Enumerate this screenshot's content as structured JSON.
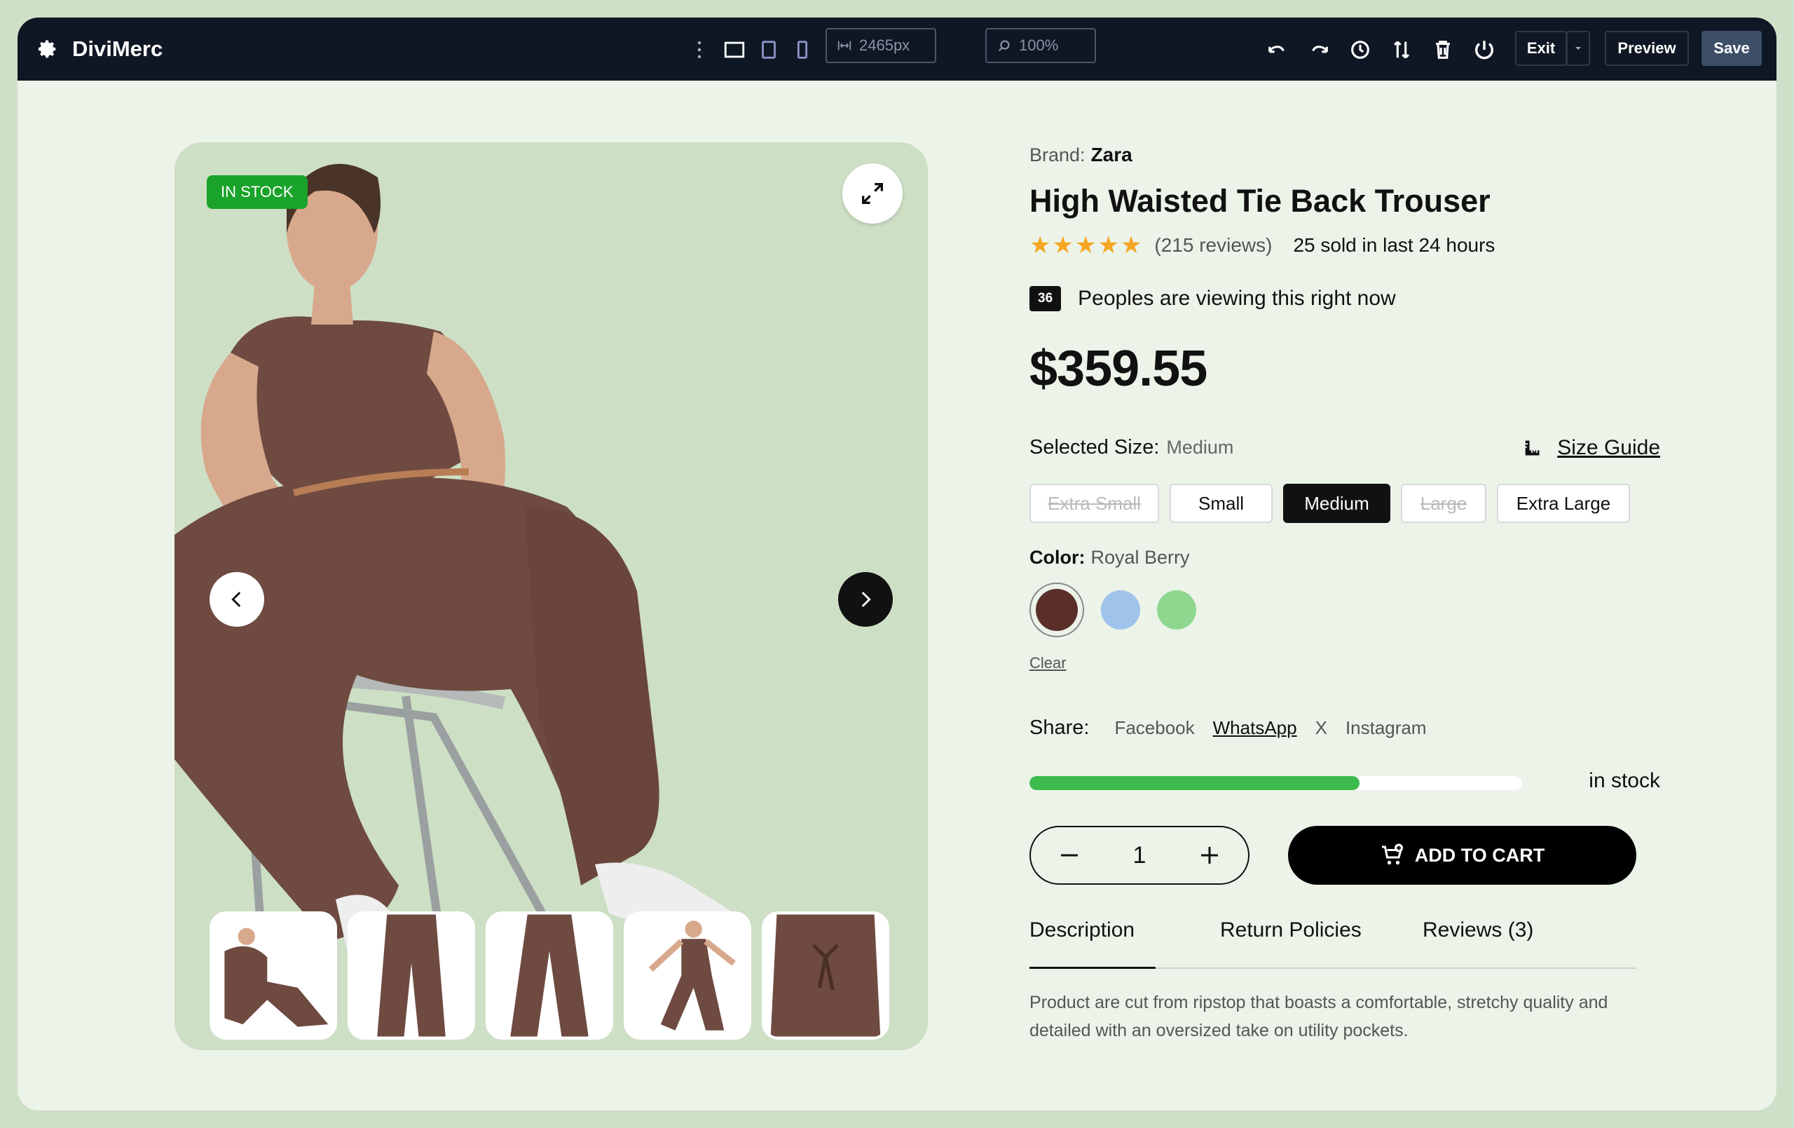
{
  "app": {
    "name": "DiviMerc",
    "width_display": "2465px",
    "zoom_display": "100%",
    "buttons": {
      "exit": "Exit",
      "preview": "Preview",
      "save": "Save"
    }
  },
  "gallery": {
    "badge": "IN STOCK",
    "thumb_count": 5
  },
  "product": {
    "brand_label": "Brand:",
    "brand": "Zara",
    "title": "High Waisted Tie Back Trouser",
    "rating": 5,
    "stars": "★★★★★",
    "reviews": "(215 reviews)",
    "sold": "25 sold in last 24 hours",
    "viewing_count": "36",
    "viewing_text": "Peoples are viewing this right now",
    "price": "$359.55",
    "size_label": "Selected Size:",
    "size_value": "Medium",
    "size_guide": "Size Guide",
    "sizes": [
      {
        "label": "Extra Small",
        "state": "disabled"
      },
      {
        "label": "Small",
        "state": "normal"
      },
      {
        "label": "Medium",
        "state": "active"
      },
      {
        "label": "Large",
        "state": "disabled"
      },
      {
        "label": "Extra Large",
        "state": "normal"
      }
    ],
    "color_label": "Color:",
    "color_value": "Royal Berry",
    "colors": [
      "#5a2f2a",
      "#9fc3ea",
      "#8fd68f"
    ],
    "clear": "Clear",
    "share_label": "Share:",
    "share_links": [
      "Facebook",
      "WhatsApp",
      "X",
      "Instagram"
    ],
    "stock_fraction": 0.67,
    "stock_text": "in stock",
    "quantity": "1",
    "add_to_cart": "ADD TO CART",
    "tabs": [
      "Description",
      "Return Policies",
      "Reviews (3)"
    ],
    "description": "Product are cut from ripstop that boasts a comfortable, stretchy quality and detailed with an oversized take on utility pockets."
  }
}
